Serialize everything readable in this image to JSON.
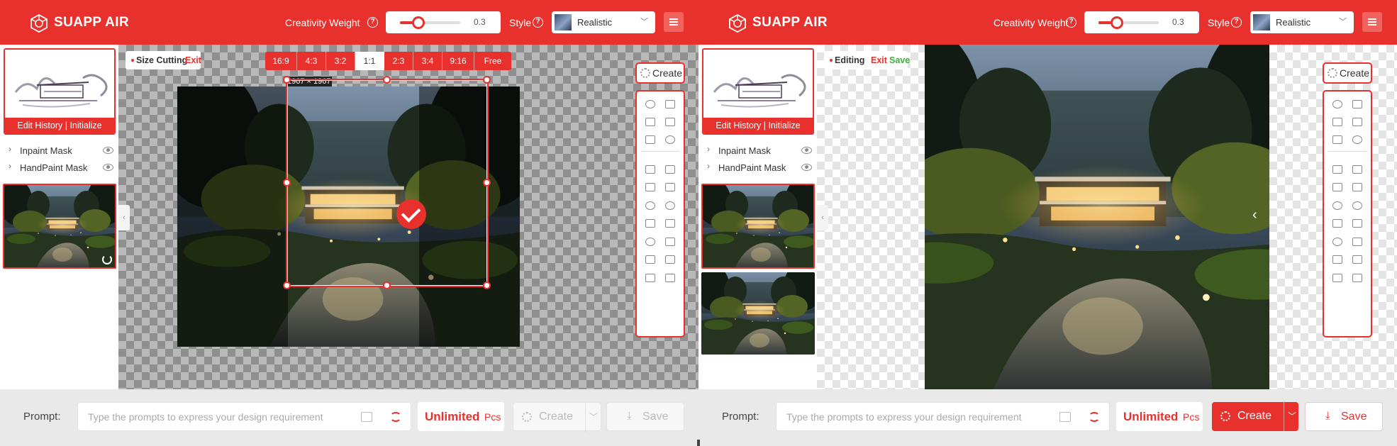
{
  "header": {
    "brand": "SUAPP AIR",
    "creativity_label": "Creativity Weight",
    "creativity_value": "0.3",
    "creativity_fraction": 0.3,
    "style_label": "Style",
    "style_value": "Realistic",
    "accent_color": "#e8312c"
  },
  "sidebar": {
    "edit_history": "Edit History | Initialize",
    "layers": [
      "Inpaint Mask",
      "HandPaint Mask"
    ]
  },
  "left": {
    "mode_label": "Size Cutting",
    "exit_label": "Exit",
    "ratios": [
      "16:9",
      "4:3",
      "3:2",
      "1:1",
      "2:3",
      "3:4",
      "9:16",
      "Free"
    ],
    "selected_ratio": "1:1",
    "crop_size": "1967 × 1967"
  },
  "right": {
    "mode_label": "Editing",
    "exit_label": "Exit",
    "save_label": "Save"
  },
  "tools": {
    "create_label": "Create"
  },
  "bottom": {
    "prompt_label": "Prompt:",
    "prompt_placeholder": "Type the prompts to express your design requirement",
    "unlimited": "Unlimited",
    "unlimited_unit": "Pcs",
    "create_label": "Create",
    "save_label": "Save"
  }
}
